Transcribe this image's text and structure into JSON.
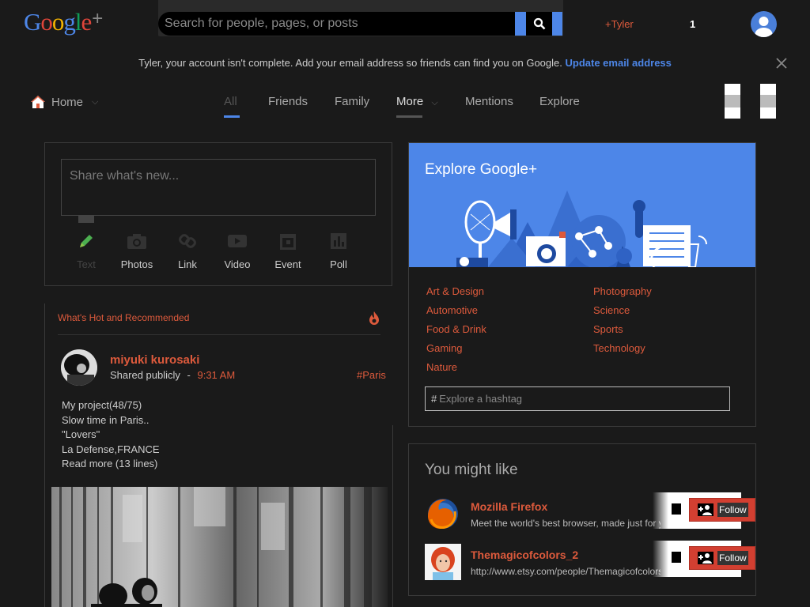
{
  "header": {
    "logo_letters": [
      "G",
      "o",
      "o",
      "g",
      "l",
      "e"
    ],
    "logo_plus": "+",
    "search_placeholder": "Search for people, pages, or posts",
    "profile_name": "+Tyler",
    "notification_count": "1"
  },
  "notice": {
    "text": "Tyler, your account isn't complete. Add your email address so friends can find you on Google.",
    "link": "Update email address"
  },
  "nav": {
    "home": "Home",
    "tabs": [
      "All",
      "Friends",
      "Family",
      "More",
      "Mentions",
      "Explore"
    ]
  },
  "share": {
    "placeholder": "Share what's new...",
    "actions": [
      "Text",
      "Photos",
      "Link",
      "Video",
      "Event",
      "Poll"
    ]
  },
  "hot": {
    "title": "What's Hot and Recommended",
    "post": {
      "author": "miyuki kurosaki",
      "visibility": "Shared publicly",
      "separator": "-",
      "time": "9:31 AM",
      "hashtag": "#Paris",
      "lines": [
        "My project(48/75)",
        "Slow time in Paris..",
        "\"Lovers\"",
        "La Defense,FRANCE",
        "Read more (13 lines)"
      ]
    }
  },
  "explore": {
    "title": "Explore Google+",
    "categories_left": [
      "Art & Design",
      "Automotive",
      "Food & Drink",
      "Gaming",
      "Nature"
    ],
    "categories_right": [
      "Photography",
      "Science",
      "Sports",
      "Technology"
    ],
    "hashtag_prefix": "#",
    "hashtag_placeholder": "Explore a hashtag"
  },
  "suggestions": {
    "title": "You might like",
    "follow_label": "Follow",
    "items": [
      {
        "name": "Mozilla Firefox",
        "desc": "Meet the world's best browser, made just for you"
      },
      {
        "name": "Themagicofcolors_2",
        "desc": "http://www.etsy.com/people/Themagicofcolors"
      }
    ]
  },
  "colors": {
    "accent_red": "#dd5a3c",
    "accent_blue": "#4d86e8",
    "logo": [
      "#4d86e8",
      "#e0453a",
      "#f4b400",
      "#4d86e8",
      "#0f9d58",
      "#e0453a"
    ]
  }
}
